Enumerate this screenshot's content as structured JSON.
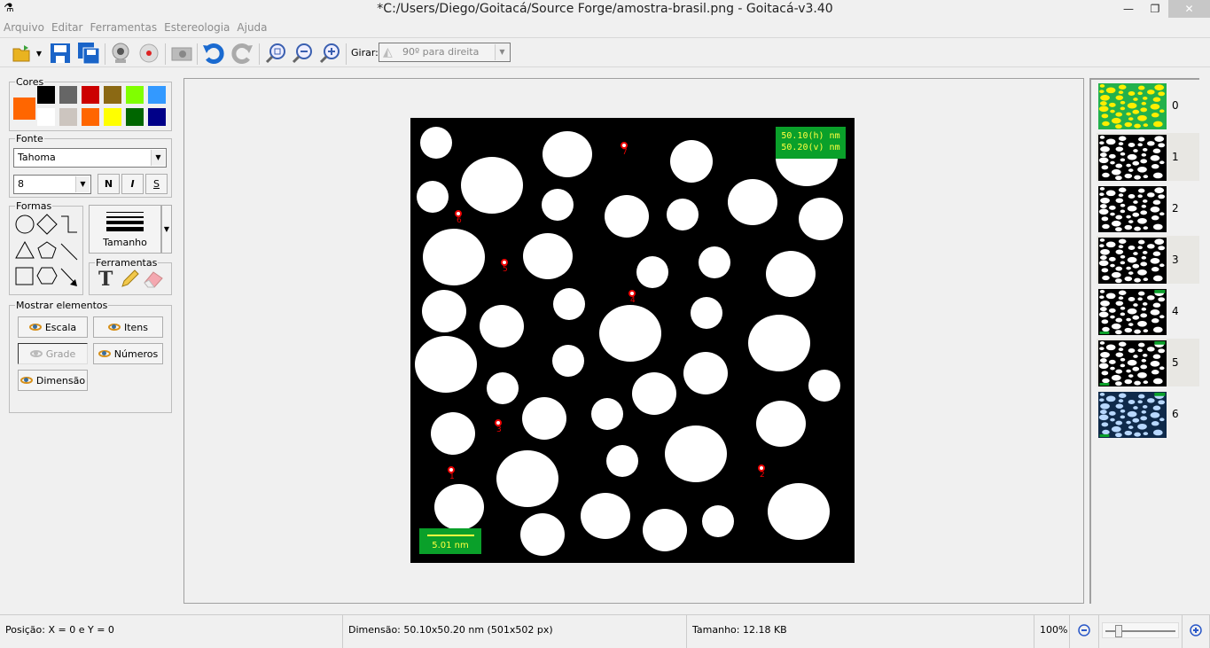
{
  "window": {
    "title": "*C:/Users/Diego/Goitacá/Source Forge/amostra-brasil.png - Goitacá-v3.40",
    "minimize": "—",
    "maximize": "❐",
    "close": "✕"
  },
  "menu": [
    "Arquivo",
    "Editar",
    "Ferramentas",
    "Estereologia",
    "Ajuda"
  ],
  "toolbar": {
    "rotate_label": "Girar:",
    "rotate_value": "90º para direita"
  },
  "colors": {
    "label": "Cores",
    "current": "#ff6600",
    "palette": [
      "#000000",
      "#666666",
      "#cc0000",
      "#8b6914",
      "#80ff00",
      "#3399ff",
      "#ffffff",
      "#ccc5bf",
      "#ff6600",
      "#ffff00",
      "#006600",
      "#000088"
    ]
  },
  "font": {
    "label": "Fonte",
    "family": "Tahoma",
    "size": "8",
    "bold": "N",
    "italic": "I",
    "underline": "S"
  },
  "shapes": {
    "label": "Formas",
    "size_label": "Tamanho"
  },
  "tools": {
    "label": "Ferramentas"
  },
  "show": {
    "label": "Mostrar elementos",
    "scale": "Escala",
    "items": "Itens",
    "grid": "Grade",
    "numbers": "Números",
    "dimension": "Dimensão"
  },
  "image": {
    "dim_h": "50.10(h) nm",
    "dim_v": "50.20(v) nm",
    "scale": "5.01 nm",
    "markers": [
      "1",
      "2",
      "3",
      "4",
      "5",
      "6",
      "7"
    ]
  },
  "thumbnails": [
    "0",
    "1",
    "2",
    "3",
    "4",
    "5",
    "6"
  ],
  "status": {
    "position": "Posição: X = 0 e Y = 0",
    "dimension": "Dimensão: 50.10x50.20 nm (501x502 px)",
    "size": "Tamanho: 12.18 KB",
    "zoom": "100%",
    "zoom_level": 0.15
  }
}
